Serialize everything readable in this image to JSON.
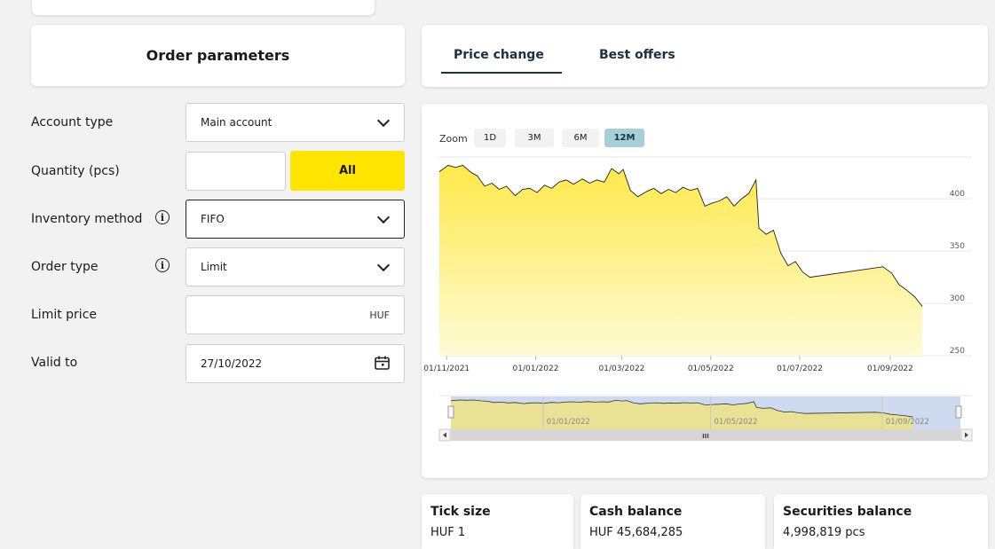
{
  "order": {
    "title": "Order parameters"
  },
  "tabs": [
    {
      "label": "Price change",
      "active": true
    },
    {
      "label": "Best offers",
      "active": false
    }
  ],
  "form": {
    "account_type": {
      "label": "Account type",
      "value": "Main account"
    },
    "quantity": {
      "label": "Quantity (pcs)",
      "value": "",
      "all_label": "All"
    },
    "inventory_method": {
      "label": "Inventory method",
      "value": "FIFO"
    },
    "order_type": {
      "label": "Order type",
      "value": "Limit"
    },
    "limit_price": {
      "label": "Limit price",
      "value": "",
      "unit": "HUF"
    },
    "valid_to": {
      "label": "Valid to",
      "value": "27/10/2022"
    }
  },
  "info_glyph": "i",
  "zoom": {
    "label": "Zoom",
    "options": [
      "1D",
      "3M",
      "6M",
      "12M"
    ],
    "selected": "12M"
  },
  "chart_data": {
    "type": "area",
    "x_tick_labels": [
      "01/11/2021",
      "01/01/2022",
      "01/03/2022",
      "01/05/2022",
      "01/07/2022",
      "01/09/2022"
    ],
    "navigator_tick_labels": [
      "01/01/2022",
      "01/05/2022",
      "01/09/2022"
    ],
    "navigator_scroll_glyph": "III",
    "y_ticks": [
      250,
      300,
      350,
      400
    ],
    "ylim": [
      250,
      440
    ],
    "x_range": [
      "2021-10-27",
      "2022-10-27"
    ],
    "series": [
      {
        "points": [
          [
            "2021-10-27",
            426
          ],
          [
            "2021-11-02",
            432
          ],
          [
            "2021-11-07",
            430
          ],
          [
            "2021-11-12",
            432
          ],
          [
            "2021-11-18",
            425
          ],
          [
            "2021-11-22",
            422
          ],
          [
            "2021-11-27",
            412
          ],
          [
            "2021-12-02",
            415
          ],
          [
            "2021-12-07",
            409
          ],
          [
            "2021-12-12",
            412
          ],
          [
            "2021-12-18",
            403
          ],
          [
            "2021-12-23",
            409
          ],
          [
            "2021-12-28",
            410
          ],
          [
            "2022-01-02",
            406
          ],
          [
            "2022-01-07",
            413
          ],
          [
            "2022-01-12",
            410
          ],
          [
            "2022-01-17",
            416
          ],
          [
            "2022-01-22",
            418
          ],
          [
            "2022-01-27",
            414
          ],
          [
            "2022-02-02",
            419
          ],
          [
            "2022-02-07",
            415
          ],
          [
            "2022-02-12",
            418
          ],
          [
            "2022-02-17",
            416
          ],
          [
            "2022-02-22",
            429
          ],
          [
            "2022-02-27",
            424
          ],
          [
            "2022-03-02",
            428
          ],
          [
            "2022-03-07",
            408
          ],
          [
            "2022-03-12",
            402
          ],
          [
            "2022-03-18",
            407
          ],
          [
            "2022-03-23",
            410
          ],
          [
            "2022-03-28",
            405
          ],
          [
            "2022-04-02",
            409
          ],
          [
            "2022-04-07",
            406
          ],
          [
            "2022-04-12",
            411
          ],
          [
            "2022-04-17",
            408
          ],
          [
            "2022-04-22",
            410
          ],
          [
            "2022-04-27",
            393
          ],
          [
            "2022-05-02",
            396
          ],
          [
            "2022-05-07",
            398
          ],
          [
            "2022-05-12",
            402
          ],
          [
            "2022-05-17",
            393
          ],
          [
            "2022-05-22",
            400
          ],
          [
            "2022-05-27",
            405
          ],
          [
            "2022-06-01",
            418
          ],
          [
            "2022-06-03",
            372
          ],
          [
            "2022-06-08",
            366
          ],
          [
            "2022-06-13",
            370
          ],
          [
            "2022-06-18",
            348
          ],
          [
            "2022-06-23",
            336
          ],
          [
            "2022-06-28",
            340
          ],
          [
            "2022-07-03",
            330
          ],
          [
            "2022-07-08",
            325
          ],
          [
            "2022-08-27",
            335
          ],
          [
            "2022-09-02",
            329
          ],
          [
            "2022-09-07",
            318
          ],
          [
            "2022-09-12",
            313
          ],
          [
            "2022-09-18",
            306
          ],
          [
            "2022-09-23",
            297
          ]
        ]
      }
    ]
  },
  "stats": [
    {
      "label": "Tick size",
      "value": "HUF 1"
    },
    {
      "label": "Cash balance",
      "value": "HUF 45,684,285"
    },
    {
      "label": "Securities balance",
      "value": "4,998,819 pcs"
    }
  ]
}
